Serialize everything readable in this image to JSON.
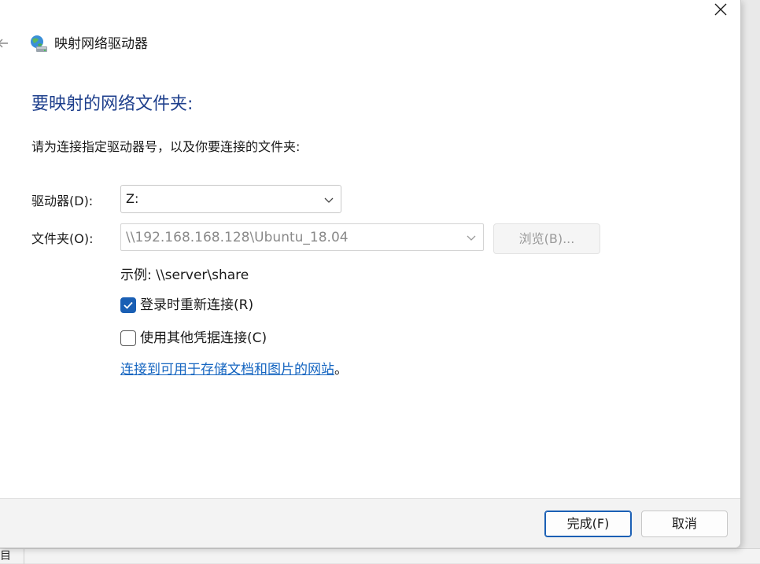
{
  "window": {
    "title": "映射网络驱动器"
  },
  "main": {
    "heading": "要映射的网络文件夹:",
    "instruction": "请为连接指定驱动器号，以及你要连接的文件夹:",
    "drive_label": "驱动器(D):",
    "drive_value": "Z:",
    "folder_label": "文件夹(O):",
    "folder_value": "\\\\192.168.168.128\\Ubuntu_18.04",
    "browse_label": "浏览(B)...",
    "example_text": "示例: \\\\server\\share",
    "reconnect_label": "登录时重新连接(R)",
    "reconnect_checked": true,
    "other_credentials_label": "使用其他凭据连接(C)",
    "other_credentials_checked": false,
    "link_text": "连接到可用于存储文档和图片的网站",
    "link_suffix": "。"
  },
  "footer": {
    "finish_label": "完成(F)",
    "cancel_label": "取消"
  },
  "background": {
    "partial_text": "目"
  },
  "colors": {
    "heading": "#1e3f8c",
    "accent": "#1a5fb4",
    "link": "#1565c0"
  },
  "icons": [
    "close-icon",
    "back-arrow-icon",
    "network-drive-icon",
    "chevron-down-icon",
    "checkmark-icon"
  ]
}
